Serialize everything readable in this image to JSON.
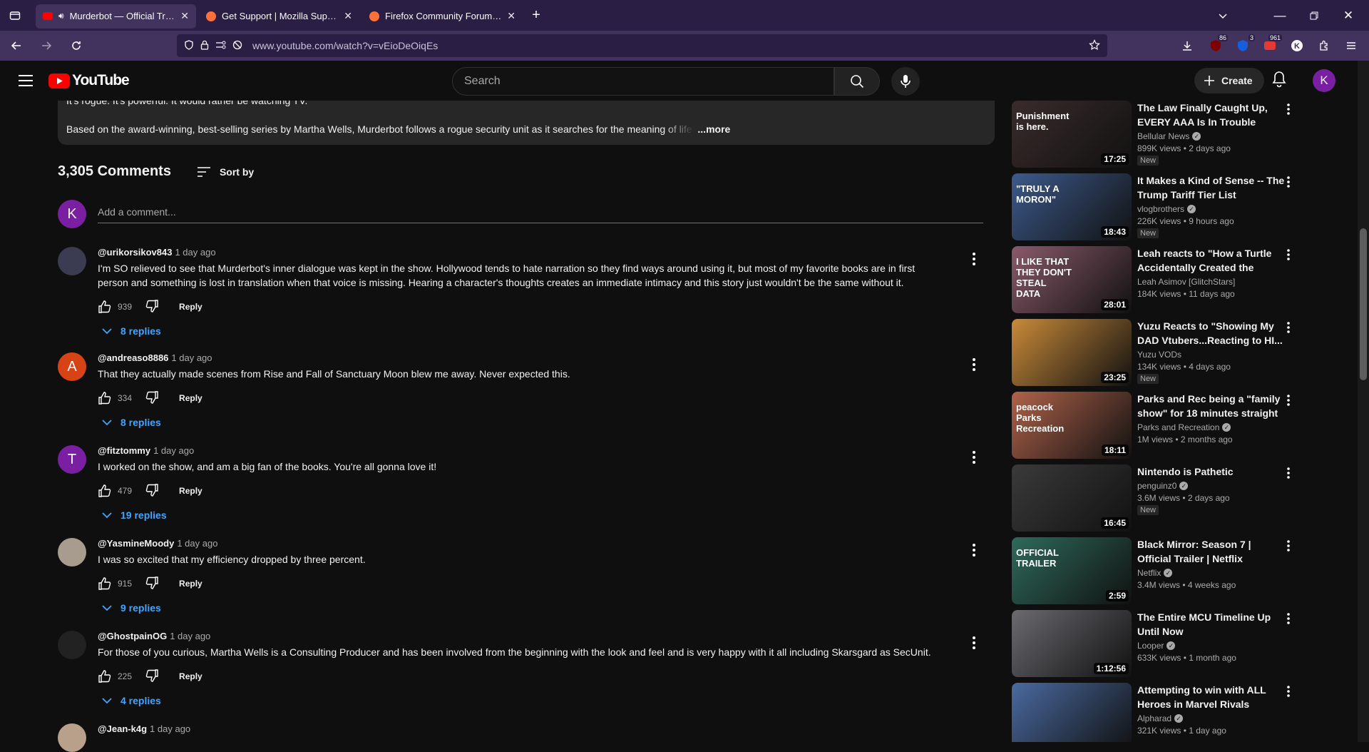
{
  "browser": {
    "tabs": [
      {
        "label": "Murderbot — Official Trailer",
        "active": true,
        "favicon": "youtube-icon"
      },
      {
        "label": "Get Support | Mozilla Support",
        "active": false,
        "favicon": "firefox-icon"
      },
      {
        "label": "Firefox Community Forum | Mozilla",
        "active": false,
        "favicon": "firefox-icon"
      }
    ],
    "url": "www.youtube.com/watch?v=vEioDeOiqEs",
    "ext_badges": {
      "ublock": "86",
      "bitwarden": "3",
      "extra": "961"
    }
  },
  "youtube": {
    "logo": "YouTube",
    "search_placeholder": "Search",
    "create_label": "Create",
    "avatar_letter": "K"
  },
  "description": {
    "line1": "It's rogue. It's powerful. It would rather be watching TV.",
    "line2": "Based on the award-winning, best-selling series by Martha Wells, Murderbot follows a rogue security unit as it searches for the meaning of life.",
    "more": "...more"
  },
  "comments_header": {
    "count": "3,305 Comments",
    "sort_label": "Sort by",
    "add_placeholder": "Add a comment...",
    "add_avatar": "K"
  },
  "comments": [
    {
      "user": "@urikorsikov843",
      "time": "1 day ago",
      "text": "I'm SO relieved to see that Murderbot's inner dialogue was kept in the show. Hollywood tends to hate narration so they find ways around using it, but most of my favorite books are in first person and something is lost in translation when that voice is missing. Hearing a character's thoughts creates an immediate intimacy and this story just wouldn't be the same without it.",
      "likes": "939",
      "reply": "Reply",
      "replies": "8 replies",
      "avatar_letter": "",
      "avatar_color": "#3b3b52"
    },
    {
      "user": "@andreaso8886",
      "time": "1 day ago",
      "text": "That they actually made scenes from Rise and Fall of Sanctuary Moon blew me away. Never expected this.",
      "likes": "334",
      "reply": "Reply",
      "replies": "8 replies",
      "avatar_letter": "A",
      "avatar_color": "#d84315"
    },
    {
      "user": "@fitztommy",
      "time": "1 day ago",
      "text": "I worked on the show, and am a big fan of the books. You're all gonna love it!",
      "likes": "479",
      "reply": "Reply",
      "replies": "19 replies",
      "avatar_letter": "T",
      "avatar_color": "#7b1fa2"
    },
    {
      "user": "@YasmineMoody",
      "time": "1 day ago",
      "text": "I was so excited that my efficiency dropped by three percent.",
      "likes": "915",
      "reply": "Reply",
      "replies": "9 replies",
      "avatar_letter": "",
      "avatar_color": "#a89c8f"
    },
    {
      "user": "@GhostpainOG",
      "time": "1 day ago",
      "text": "For those of you curious, Martha Wells is a Consulting Producer and has been involved from the beginning with the look and feel and is very happy with it all including Skarsgard as SecUnit.",
      "likes": "225",
      "reply": "Reply",
      "replies": "4 replies",
      "avatar_letter": "",
      "avatar_color": "#222"
    },
    {
      "user": "@Jean-k4g",
      "time": "1 day ago",
      "text": "",
      "likes": "",
      "reply": "",
      "replies": "",
      "avatar_letter": "",
      "avatar_color": "#b9a08a"
    }
  ],
  "sidebar": [
    {
      "title": "The Law Finally Caught Up, EVERY AAA Is In Trouble",
      "channel": "Bellular News",
      "verified": true,
      "stats": "899K views • 2 days ago",
      "new": "New",
      "duration": "17:25",
      "thumb_color": "#3a2b2b",
      "thumb_text": "Punishment is here."
    },
    {
      "title": "It Makes a Kind of Sense -- The Trump Tariff Tier List",
      "channel": "vlogbrothers",
      "verified": true,
      "stats": "226K views • 9 hours ago",
      "new": "New",
      "duration": "18:43",
      "thumb_color": "#3d5a8c",
      "thumb_text": "\"TRULY A MORON\""
    },
    {
      "title": "Leah reacts to \"How a Turtle Accidentally Created the Perfe...",
      "channel": "Leah Asimov [GlitchStars]",
      "verified": false,
      "stats": "184K views • 11 days ago",
      "new": "",
      "duration": "28:01",
      "thumb_color": "#8a5a6a",
      "thumb_text": "I LIKE THAT THEY DON'T STEAL DATA"
    },
    {
      "title": "Yuzu Reacts to \"Showing My DAD Vtubers...Reacting to HI...",
      "channel": "Yuzu VODs",
      "verified": false,
      "stats": "134K views • 4 days ago",
      "new": "New",
      "duration": "23:25",
      "thumb_color": "#c98a3a",
      "thumb_text": ""
    },
    {
      "title": "Parks and Rec being a \"family show\" for 18 minutes straight",
      "channel": "Parks and Recreation",
      "verified": true,
      "stats": "1M views • 2 months ago",
      "new": "",
      "duration": "18:11",
      "thumb_color": "#b0624a",
      "thumb_text": "peacock Parks Recreation"
    },
    {
      "title": "Nintendo is Pathetic",
      "channel": "penguinz0",
      "verified": true,
      "stats": "3.6M views • 2 days ago",
      "new": "New",
      "duration": "16:45",
      "thumb_color": "#3a3a3a",
      "thumb_text": ""
    },
    {
      "title": "Black Mirror: Season 7 | Official Trailer | Netflix",
      "channel": "Netflix",
      "verified": true,
      "stats": "3.4M views • 4 weeks ago",
      "new": "",
      "duration": "2:59",
      "thumb_color": "#2e6a5a",
      "thumb_text": "OFFICIAL TRAILER"
    },
    {
      "title": "The Entire MCU Timeline Up Until Now",
      "channel": "Looper",
      "verified": true,
      "stats": "633K views • 1 month ago",
      "new": "",
      "duration": "1:12:56",
      "thumb_color": "#6a6a70",
      "thumb_text": ""
    },
    {
      "title": "Attempting to win with ALL Heroes in Marvel Rivals",
      "channel": "Alpharad",
      "verified": true,
      "stats": "321K views • 1 day ago",
      "new": "",
      "duration": "",
      "thumb_color": "#4a6aa0",
      "thumb_text": ""
    }
  ]
}
